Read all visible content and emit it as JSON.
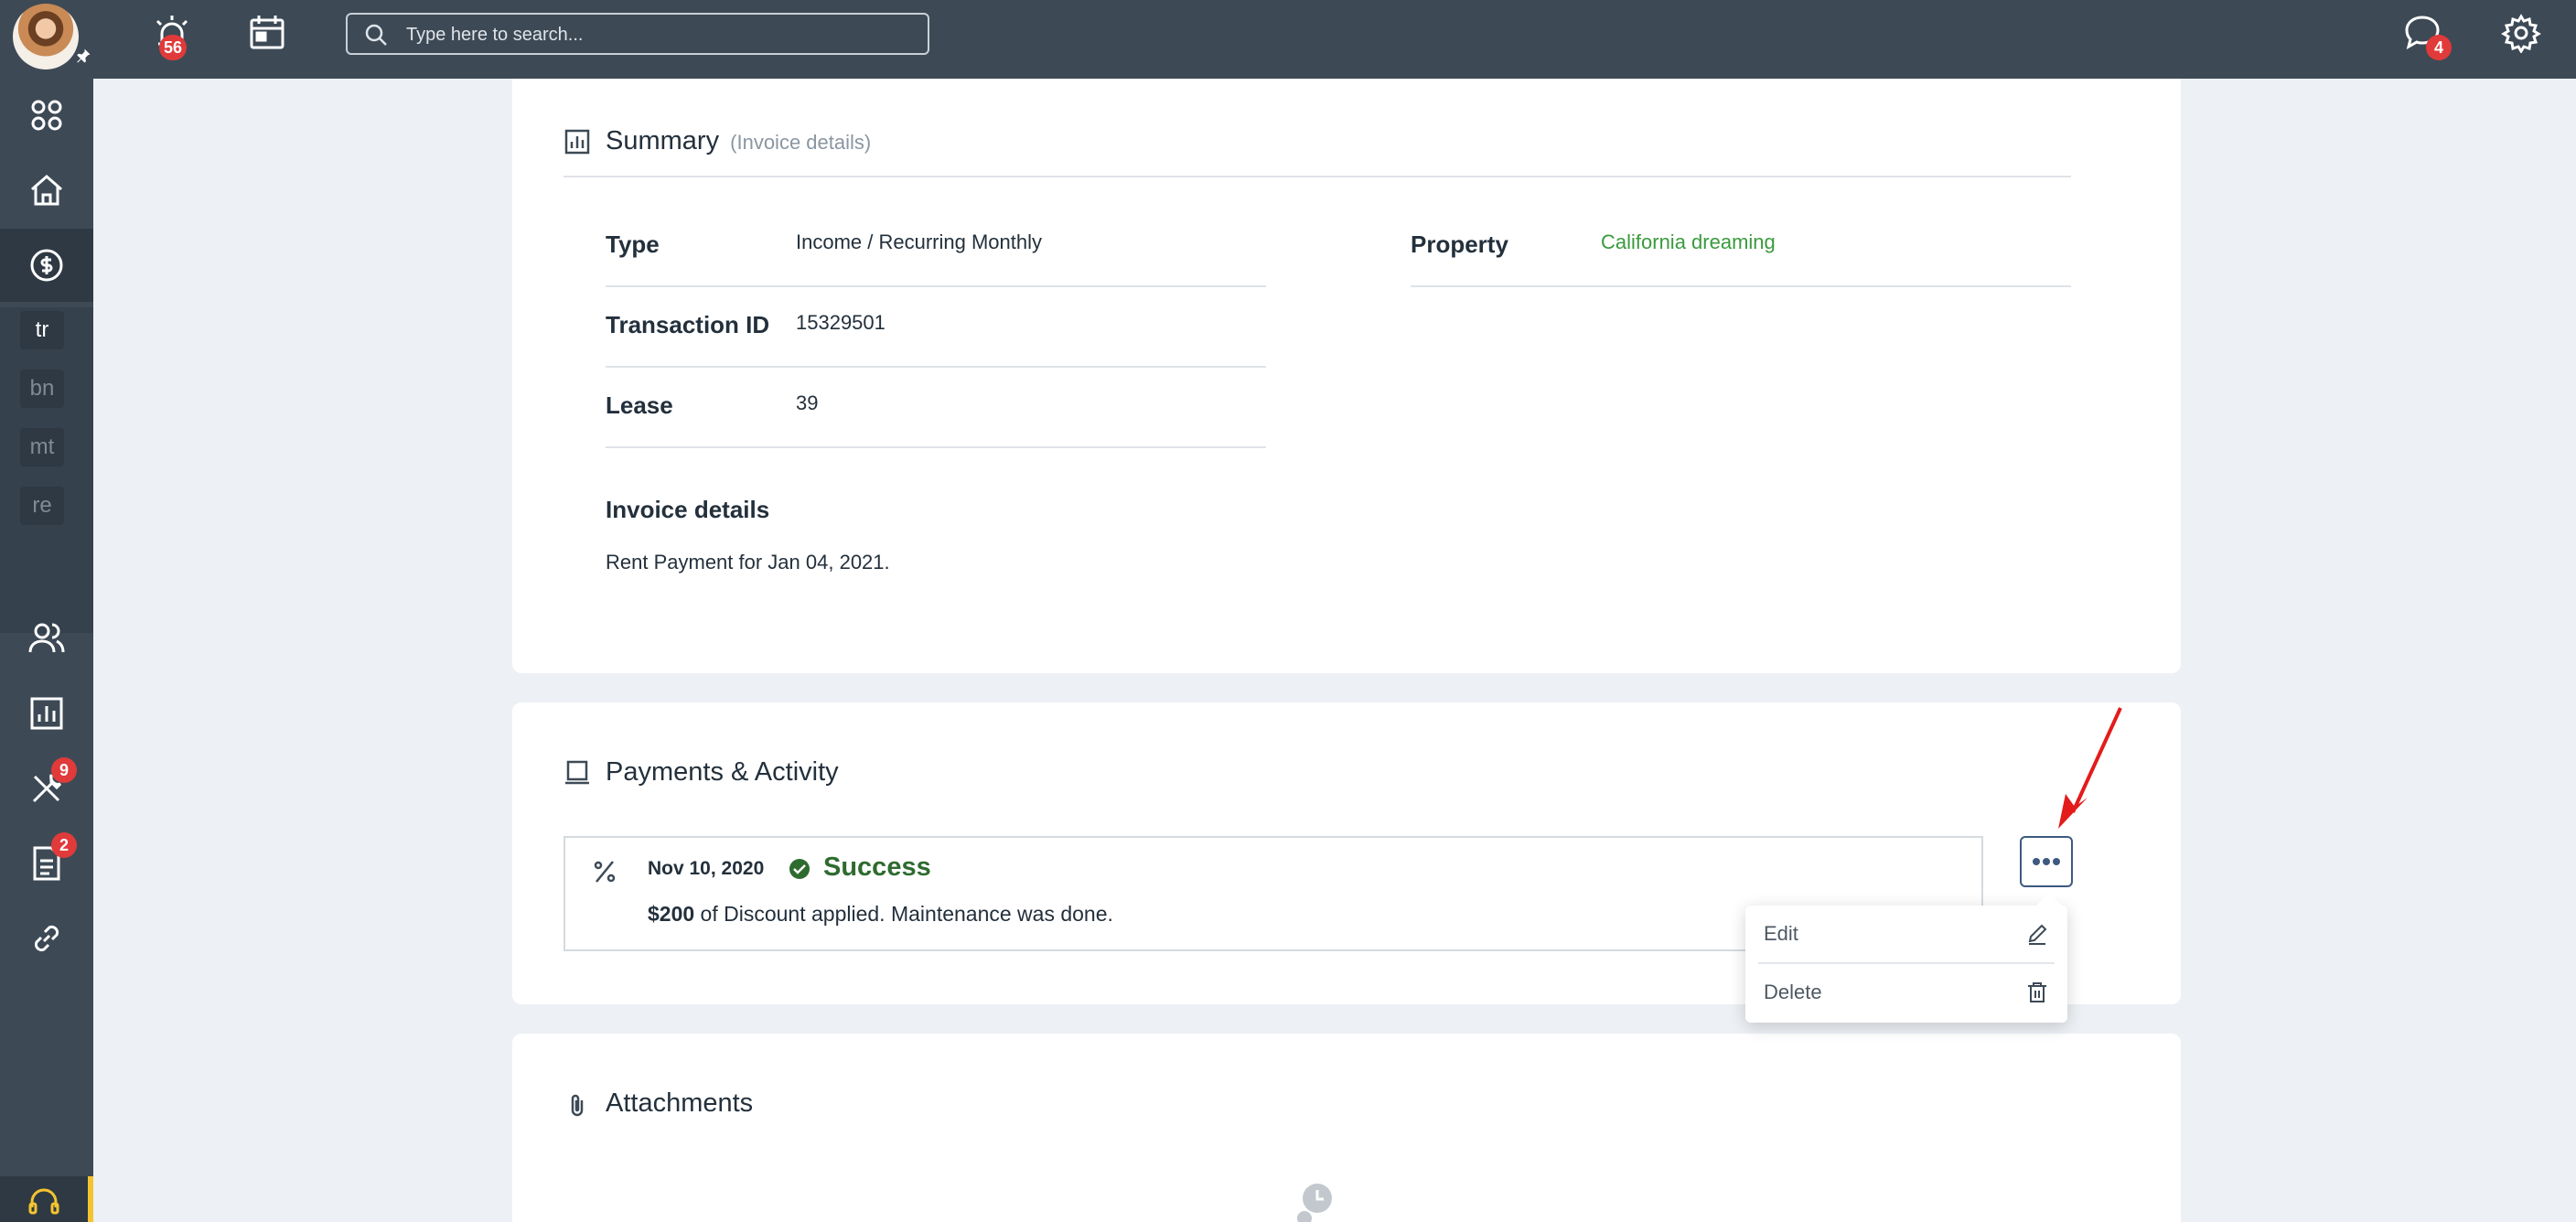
{
  "topbar": {
    "alerts_badge": "56",
    "search_placeholder": "Type here to search...",
    "messages_badge": "4"
  },
  "sidebar": {
    "abbr_items": [
      "tr",
      "bn",
      "mt",
      "re"
    ],
    "maintenance_badge": "9",
    "documents_badge": "2"
  },
  "summary": {
    "title": "Summary",
    "subtitle": "(Invoice details)",
    "type_label": "Type",
    "type_value": "Income / Recurring Monthly",
    "property_label": "Property",
    "property_value": "California dreaming",
    "transaction_label": "Transaction ID",
    "transaction_value": "15329501",
    "lease_label": "Lease",
    "lease_value": "39",
    "invoice_details_label": "Invoice details",
    "invoice_details_value": "Rent Payment for Jan 04, 2021."
  },
  "payments": {
    "title": "Payments & Activity",
    "date": "Nov 10, 2020",
    "status": "Success",
    "amount": "$200",
    "description": " of Discount applied. Maintenance was done.",
    "menu_edit": "Edit",
    "menu_delete": "Delete"
  },
  "attachments": {
    "title": "Attachments"
  },
  "colors": {
    "topbar": "#3d4a56",
    "success": "#2e6b2f",
    "link": "#3a9a3d",
    "badge": "#e03a3a",
    "arrow": "#e31b1b"
  }
}
